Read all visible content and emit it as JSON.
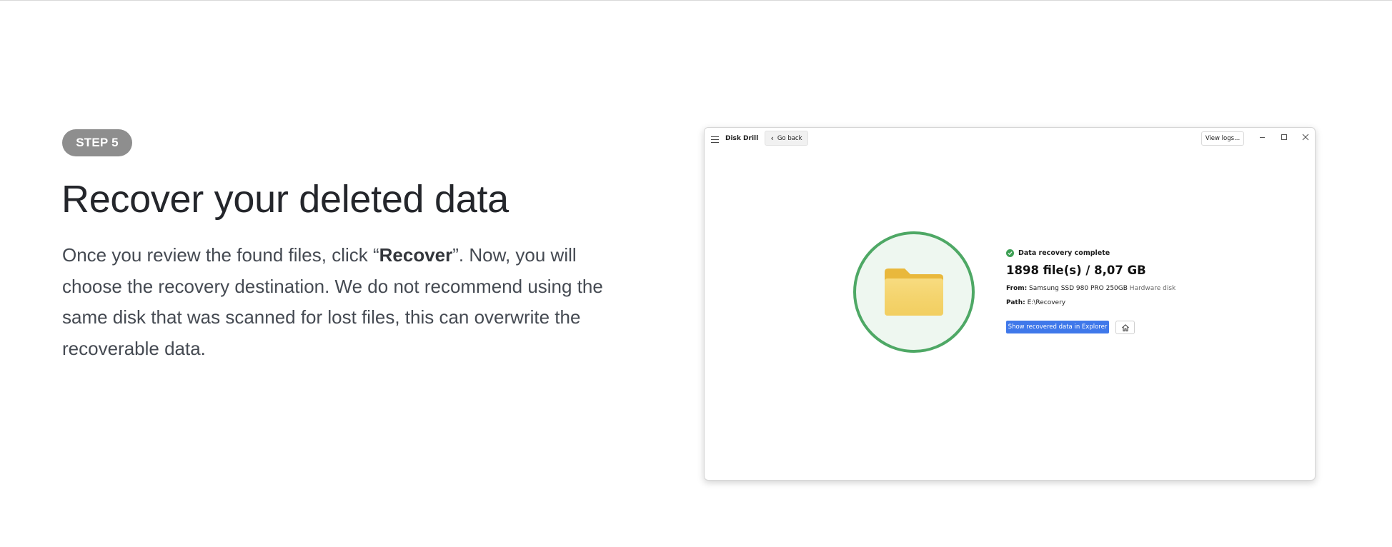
{
  "step": {
    "badge": "STEP 5"
  },
  "hero": {
    "title": "Recover your deleted data",
    "description_before": "Once you review the found files, click “",
    "description_bold": "Recover",
    "description_after": "”. Now, you will choose the recovery destination. We do not recommend using the same disk that was scanned for lost files, this can overwrite the recoverable data."
  },
  "app": {
    "title": "Disk Drill",
    "go_back_label": "Go back",
    "view_logs_label": "View logs...",
    "status": "Data recovery complete",
    "files_summary": "1898 file(s) / 8,07 GB",
    "from_label": "From:",
    "from_disk": "Samsung SSD 980 PRO 250GB",
    "from_disk_type": "Hardware disk",
    "path_label": "Path:",
    "path_value": "E:\\Recovery",
    "show_button_label": "Show recovered data in Explorer",
    "icons": [
      "hamburger-menu-icon",
      "chevron-left-icon",
      "minimize-icon",
      "maximize-icon",
      "close-icon",
      "check-circle-icon",
      "folder-icon",
      "home-icon"
    ],
    "colors": {
      "accent_blue": "#3f78ea",
      "success_green": "#4ea865",
      "folder_yellow": "#f5d36a",
      "badge_gray": "#8e8e8e"
    }
  }
}
